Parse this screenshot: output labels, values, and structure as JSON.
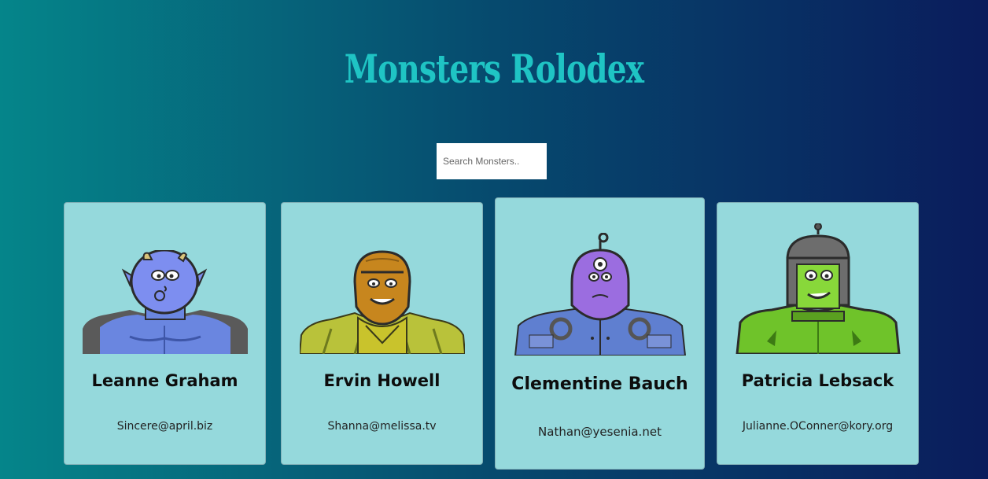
{
  "app": {
    "title": "Monsters Rolodex",
    "title_color": "#1fc4c4",
    "card_color": "#95d9dc"
  },
  "search": {
    "placeholder": "Search Monsters.."
  },
  "monsters": [
    {
      "name": "Leanne Graham",
      "email": "Sincere@april.biz",
      "avatar": "blue-monster-icon"
    },
    {
      "name": "Ervin Howell",
      "email": "Shanna@melissa.tv",
      "avatar": "yellow-monster-icon"
    },
    {
      "name": "Clementine Bauch",
      "email": "Nathan@yesenia.net",
      "avatar": "purple-cyclops-monster-icon"
    },
    {
      "name": "Patricia Lebsack",
      "email": "Julianne.OConner@kory.org",
      "avatar": "green-robot-monster-icon"
    }
  ]
}
